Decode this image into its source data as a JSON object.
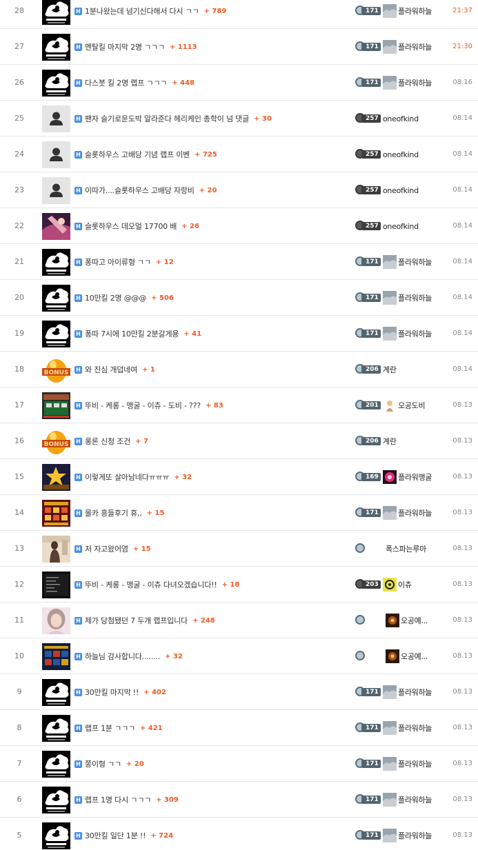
{
  "colors": {
    "accent": "#ef5a24",
    "badge": "#4a8fe7"
  },
  "posts": [
    {
      "no": "28",
      "thumb": "logo-flower",
      "badge": "H",
      "title": "1분나왔는데 넘기신다해서 다시 ㄱㄱ",
      "count": "+ 789",
      "level": "171",
      "level_style": "normal",
      "avatar": "cloud",
      "nick": "플라워하늘",
      "time": "21:37",
      "recent": true
    },
    {
      "no": "27",
      "thumb": "logo-flower",
      "badge": "H",
      "title": "멘탈킬 마지막 2명 ㄱㄱㄱ",
      "count": "+ 1113",
      "level": "171",
      "level_style": "normal",
      "avatar": "cloud",
      "nick": "플라워하늘",
      "time": "21:30",
      "recent": true
    },
    {
      "no": "26",
      "thumb": "logo-flower",
      "badge": "H",
      "title": "다스붓 킬 2명 랩프 ㄱㄱㄱ",
      "count": "+ 448",
      "level": "171",
      "level_style": "normal",
      "avatar": "cloud",
      "nick": "플라워하늘",
      "time": "08.16",
      "recent": false
    },
    {
      "no": "25",
      "thumb": "person",
      "badge": "H",
      "title": "팬자 슬기로운도박 알라준다 헤리케인 총학이 넘 댓글",
      "count": "+ 30",
      "level": "257",
      "level_style": "dark",
      "avatar": "",
      "nick": "oneofkind",
      "time": "08.14",
      "recent": false
    },
    {
      "no": "24",
      "thumb": "person",
      "badge": "H",
      "title": "슬롯하우스 고배당 기념 랩프 이벤",
      "count": "+ 725",
      "level": "257",
      "level_style": "dark",
      "avatar": "",
      "nick": "oneofkind",
      "time": "08.14",
      "recent": false
    },
    {
      "no": "23",
      "thumb": "person",
      "badge": "H",
      "title": "이따가....슬롯하우스 고배당 자랑비",
      "count": "+ 20",
      "level": "257",
      "level_style": "dark",
      "avatar": "",
      "nick": "oneofkind",
      "time": "08.14",
      "recent": false
    },
    {
      "no": "22",
      "thumb": "photo-pink",
      "badge": "H",
      "title": "슬롯하우스 데오얼 17700 배",
      "count": "+ 26",
      "level": "257",
      "level_style": "dark",
      "avatar": "",
      "nick": "oneofkind",
      "time": "08.14",
      "recent": false
    },
    {
      "no": "21",
      "thumb": "logo-flower",
      "badge": "H",
      "title": "퐁따고 아이류형 ㄱㄱ",
      "count": "+ 12",
      "level": "171",
      "level_style": "normal",
      "avatar": "cloud",
      "nick": "플라워하늘",
      "time": "08.14",
      "recent": false
    },
    {
      "no": "20",
      "thumb": "logo-flower",
      "badge": "H",
      "title": "10만킬 2명 @@@",
      "count": "+ 506",
      "level": "171",
      "level_style": "normal",
      "avatar": "cloud",
      "nick": "플라워하늘",
      "time": "08.14",
      "recent": false
    },
    {
      "no": "19",
      "thumb": "logo-flower",
      "badge": "H",
      "title": "퐁따 7시에 10만킬 2분갈게용",
      "count": "+ 41",
      "level": "171",
      "level_style": "normal",
      "avatar": "cloud",
      "nick": "플라워하늘",
      "time": "08.14",
      "recent": false
    },
    {
      "no": "18",
      "thumb": "bonus",
      "badge": "H",
      "title": "와 진심 개덥네여",
      "count": "+ 1",
      "level": "206",
      "level_style": "normal",
      "avatar": "",
      "nick": "계란",
      "time": "08.14",
      "recent": false
    },
    {
      "no": "17",
      "thumb": "game-green",
      "badge": "H",
      "title": "뚜비 - 케롱 - 맹굴 - 이츄 - 도비 - ???",
      "count": "+ 83",
      "level": "201",
      "level_style": "normal",
      "avatar": "figure",
      "nick": "오공도비",
      "time": "08.13",
      "recent": false
    },
    {
      "no": "16",
      "thumb": "bonus",
      "badge": "H",
      "title": "롱론 신청 조건",
      "count": "+ 7",
      "level": "206",
      "level_style": "normal",
      "avatar": "",
      "nick": "계란",
      "time": "08.13",
      "recent": false
    },
    {
      "no": "15",
      "thumb": "game-gold",
      "badge": "H",
      "title": "이렇게또 살아남네다ㅠㅠㅠ",
      "count": "+ 32",
      "level": "169",
      "level_style": "normal",
      "avatar": "flower",
      "nick": "플라워맹굴",
      "time": "08.13",
      "recent": false
    },
    {
      "no": "14",
      "thumb": "game-red",
      "badge": "H",
      "title": "몰카 흥들후기 휴,,",
      "count": "+ 15",
      "level": "171",
      "level_style": "normal",
      "avatar": "cloud",
      "nick": "플라워하늘",
      "time": "08.13",
      "recent": false
    },
    {
      "no": "13",
      "thumb": "photo-tan",
      "badge": "H",
      "title": "저 자고왔어염",
      "count": "+ 15",
      "level": "",
      "level_style": "plain",
      "avatar": "",
      "nick": "폭스파는루아",
      "time": "08.13",
      "recent": false
    },
    {
      "no": "12",
      "thumb": "dark-screen",
      "badge": "H",
      "title": "뚜비 - 케롱 - 맹굴 - 이츄 다녀오겠습니다!!",
      "count": "+ 18",
      "level": "203",
      "level_style": "dark",
      "avatar": "biohazard",
      "nick": "이츄",
      "time": "08.13",
      "recent": false
    },
    {
      "no": "11",
      "thumb": "photo-girl",
      "badge": "H",
      "title": "제가 당첨됐던 7 두개 랩프입니다",
      "count": "+ 248",
      "level": "",
      "level_style": "plain",
      "avatar": "dark-game",
      "nick": "오공예...",
      "time": "08.13",
      "recent": false
    },
    {
      "no": "10",
      "thumb": "game-blue",
      "badge": "H",
      "title": "하늘님 감사합니다........",
      "count": "+ 32",
      "level": "",
      "level_style": "plain",
      "avatar": "dark-game",
      "nick": "오공예...",
      "time": "08.13",
      "recent": false
    },
    {
      "no": "9",
      "thumb": "logo-flower",
      "badge": "H",
      "title": "30만킬 마지막 !!",
      "count": "+ 402",
      "level": "171",
      "level_style": "normal",
      "avatar": "cloud",
      "nick": "플라워하늘",
      "time": "08.13",
      "recent": false
    },
    {
      "no": "8",
      "thumb": "logo-flower",
      "badge": "H",
      "title": "랩프 1분 ㄱㄱㄱ",
      "count": "+ 421",
      "level": "171",
      "level_style": "normal",
      "avatar": "cloud",
      "nick": "플라워하늘",
      "time": "08.13",
      "recent": false
    },
    {
      "no": "7",
      "thumb": "logo-flower",
      "badge": "H",
      "title": "쫑이형 ㄱㄱ",
      "count": "+ 20",
      "level": "171",
      "level_style": "normal",
      "avatar": "cloud",
      "nick": "플라워하늘",
      "time": "08.13",
      "recent": false
    },
    {
      "no": "6",
      "thumb": "logo-flower",
      "badge": "H",
      "title": "랩프 1명 다시 ㄱㄱㄱ",
      "count": "+ 309",
      "level": "171",
      "level_style": "normal",
      "avatar": "cloud",
      "nick": "플라워하늘",
      "time": "08.13",
      "recent": false
    },
    {
      "no": "5",
      "thumb": "logo-flower",
      "badge": "H",
      "title": "30만킬 일단 1분 !!",
      "count": "+ 724",
      "level": "171",
      "level_style": "normal",
      "avatar": "cloud",
      "nick": "플라워하늘",
      "time": "08.13",
      "recent": false
    }
  ]
}
